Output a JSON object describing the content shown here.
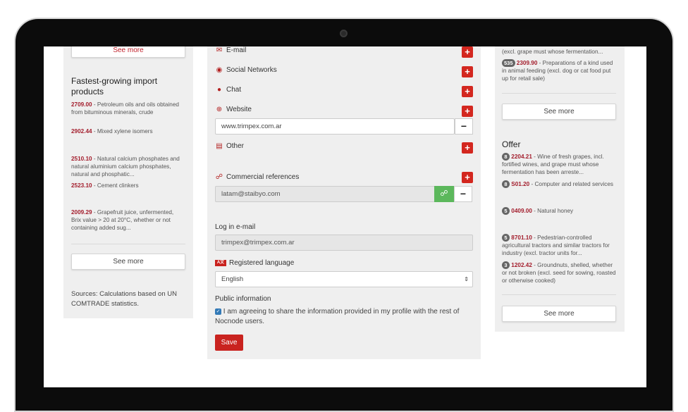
{
  "left": {
    "see_more_top": "See more",
    "title": "Fastest-growing import products",
    "items": [
      {
        "code": "2709.00",
        "text": " - Petroleum oils and oils obtained from bituminous minerals, crude"
      },
      {
        "code": "2902.44",
        "text": " - Mixed xylene isomers"
      },
      {
        "code": "2510.10",
        "text": " - Natural calcium phosphates and natural aluminium calcium phosphates, natural and phosphatic..."
      },
      {
        "code": "2523.10",
        "text": " - Cement clinkers"
      },
      {
        "code": "2009.29",
        "text": " - Grapefruit juice, unfermented, Brix value > 20 at 20°C, whether or not containing added sug..."
      }
    ],
    "see_more": "See more",
    "sources": "Sources: Calculations based on UN COMTRADE statistics."
  },
  "form": {
    "email_label": "E-mail",
    "social_label": "Social Networks",
    "chat_label": "Chat",
    "website_label": "Website",
    "website_value": "www.trimpex.com.ar",
    "other_label": "Other",
    "refs_label": "Commercial references",
    "refs_value": "latam@staibyo.com",
    "login_label": "Log in e-mail",
    "login_value": "trimpex@trimpex.com.ar",
    "lang_label": "Registered language",
    "lang_value": "English",
    "public_label": "Public information",
    "public_text": "I am agreeing to share the information provided in my profile with the rest of Nocnode users.",
    "save_label": "Save"
  },
  "right": {
    "top_fragment": "(excl. grape must whose fermentation...",
    "demand_item": {
      "badge": "535",
      "code": "2309.90",
      "text": " - Preparations of a kind used in animal feeding (excl. dog or cat food put up for retail sale)"
    },
    "see_more_1": "See more",
    "offer_title": "Offer",
    "offer_items": [
      {
        "badge": "8",
        "code": "2204.21",
        "text": " - Wine of fresh grapes, incl. fortified wines, and grape must whose fermentation has been arreste..."
      },
      {
        "badge": "8",
        "code": "S01.20",
        "text": " - Computer and related services"
      },
      {
        "badge": "5",
        "code": "0409.00",
        "text": " - Natural honey"
      },
      {
        "badge": "5",
        "code": "8701.10",
        "text": " - Pedestrian-controlled agricultural tractors and similar tractors for industry (excl. tractor units for..."
      },
      {
        "badge": "3",
        "code": "1202.42",
        "text": " - Groundnuts, shelled, whether or not broken (excl. seed for sowing, roasted or otherwise cooked)"
      }
    ],
    "see_more_2": "See more"
  }
}
